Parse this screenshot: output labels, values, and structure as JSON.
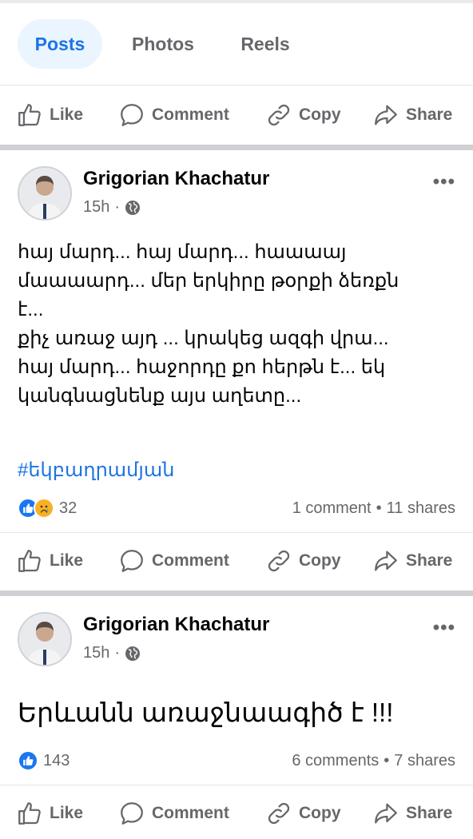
{
  "tabs": [
    {
      "label": "Posts",
      "active": true
    },
    {
      "label": "Photos",
      "active": false
    },
    {
      "label": "Reels",
      "active": false
    }
  ],
  "actions": {
    "like": "Like",
    "comment": "Comment",
    "copy": "Copy",
    "share": "Share"
  },
  "posts": [
    {
      "author": "Grigorian Khachatur",
      "time": "15h",
      "privacy_icon": "globe-icon",
      "text_lines": [
        "հայ մարդ... հայ մարդ... հաաաայ",
        "մաաաարդ... մեր երկիրը թօրքի ձեռքն",
        "է...",
        "քիչ առաջ այդ ... կրակեց ազգի վրա...",
        "հայ մարդ... հաջորդը քո հերթն է... եկ",
        "կանգնացնենք այս աղետը..."
      ],
      "hashtag": "#եկբաղրամյան",
      "reactions": [
        "like",
        "sad"
      ],
      "reaction_count": "32",
      "comments": "1 comment",
      "shares": "11 shares"
    },
    {
      "author": "Grigorian Khachatur",
      "time": "15h",
      "privacy_icon": "globe-icon",
      "text": "Երևանն առաջնաագիծ է !!!",
      "reactions": [
        "like"
      ],
      "reaction_count": "143",
      "comments": "6 comments",
      "shares": "7 shares"
    }
  ],
  "colors": {
    "accent": "#1b74e4",
    "active_tab_bg": "#ebf5ff",
    "muted_text": "#65676b",
    "separator": "#ced0d4",
    "like_blue": "#1877f2",
    "sad_yellow": "#f7b125"
  }
}
